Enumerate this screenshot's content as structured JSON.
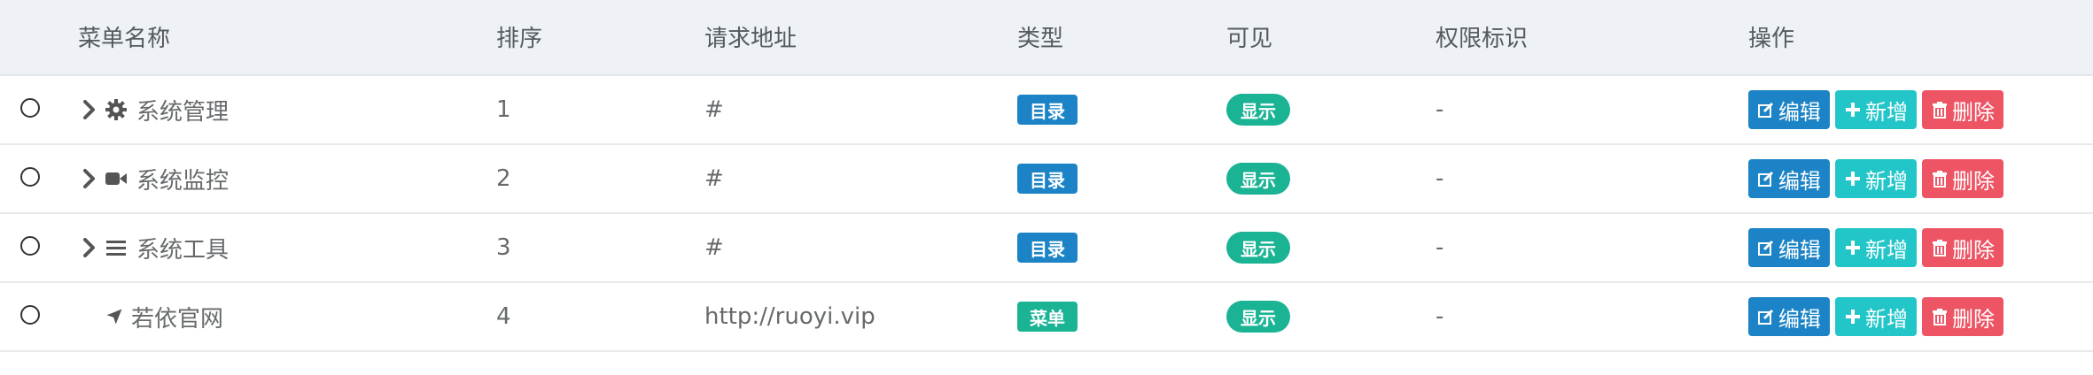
{
  "table": {
    "headers": {
      "name": "菜单名称",
      "order": "排序",
      "url": "请求地址",
      "type": "类型",
      "visible": "可见",
      "perms": "权限标识",
      "ops": "操作"
    },
    "rows": [
      {
        "name": "系统管理",
        "icon": "gear-icon",
        "expandable": true,
        "order": "1",
        "url": "#",
        "type": "目录",
        "type_color": "#1c84c6",
        "visible": "显示",
        "perms": "-"
      },
      {
        "name": "系统监控",
        "icon": "video-camera-icon",
        "expandable": true,
        "order": "2",
        "url": "#",
        "type": "目录",
        "type_color": "#1c84c6",
        "visible": "显示",
        "perms": "-"
      },
      {
        "name": "系统工具",
        "icon": "bars-icon",
        "expandable": true,
        "order": "3",
        "url": "#",
        "type": "目录",
        "type_color": "#1c84c6",
        "visible": "显示",
        "perms": "-"
      },
      {
        "name": "若依官网",
        "icon": "location-arrow-icon",
        "expandable": false,
        "order": "4",
        "url": "http://ruoyi.vip",
        "type": "菜单",
        "type_color": "#1ab394",
        "visible": "显示",
        "perms": "-"
      }
    ],
    "actions": {
      "edit": "编辑",
      "add": "新增",
      "delete": "删除"
    }
  },
  "colors": {
    "edit": "#1c84c6",
    "add": "#23c6c8",
    "delete": "#ed5565",
    "visible": "#1ab394",
    "header_bg": "#eef1f5"
  }
}
